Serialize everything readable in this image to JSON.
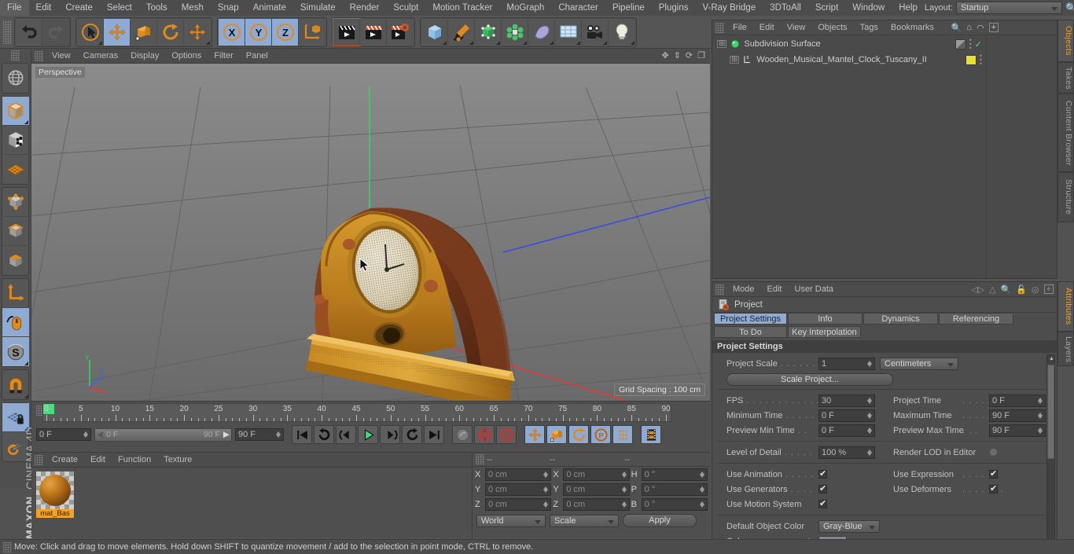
{
  "app": {
    "name": "MAXON CINEMA 4D",
    "brand_line1": "MAXON",
    "brand_line2": "CINEMA 4D"
  },
  "menubar": {
    "items": [
      "File",
      "Edit",
      "Create",
      "Select",
      "Tools",
      "Mesh",
      "Snap",
      "Animate",
      "Simulate",
      "Render",
      "Sculpt",
      "Motion Tracker",
      "MoGraph",
      "Character",
      "Pipeline",
      "Plugins",
      "V-Ray Bridge",
      "3DToAll",
      "Script",
      "Window",
      "Help"
    ],
    "layout_label": "Layout:",
    "layout_value": "Startup",
    "search_icon": "search-icon"
  },
  "toolbar": {
    "groups": [
      {
        "name": "undo-redo",
        "buttons": [
          {
            "name": "undo-button",
            "icon": "undo-arrow-icon",
            "active": false,
            "enabled": true
          },
          {
            "name": "redo-button",
            "icon": "redo-arrow-icon",
            "active": false,
            "enabled": false
          }
        ]
      },
      {
        "name": "transform-tools",
        "buttons": [
          {
            "name": "live-selection-tool",
            "icon": "cursor-circle-icon",
            "active": false,
            "corner": true
          },
          {
            "name": "move-tool",
            "icon": "move-arrows-icon",
            "active": true
          },
          {
            "name": "scale-tool",
            "icon": "scale-box-icon",
            "active": false
          },
          {
            "name": "rotate-tool",
            "icon": "rotate-arc-icon",
            "active": false
          },
          {
            "name": "move-duplicate-tool",
            "icon": "move-arrows-icon",
            "active": false,
            "corner": true
          }
        ]
      },
      {
        "name": "axis-locks",
        "buttons": [
          {
            "name": "lock-x-axis",
            "icon": "x-axis-icon",
            "label": "X",
            "active": true
          },
          {
            "name": "lock-y-axis",
            "icon": "y-axis-icon",
            "label": "Y",
            "active": true
          },
          {
            "name": "lock-z-axis",
            "icon": "z-axis-icon",
            "label": "Z",
            "active": true
          },
          {
            "name": "world-object-coordinates",
            "icon": "world-axis-cube-icon",
            "active": false
          }
        ]
      },
      {
        "name": "render-tools",
        "buttons": [
          {
            "name": "render-view-button",
            "icon": "clapperboard-icon",
            "active": false,
            "selected": true
          },
          {
            "name": "render-region-button",
            "icon": "clapperboard-region-icon",
            "active": false
          },
          {
            "name": "render-settings-button",
            "icon": "clapperboard-gear-icon",
            "active": false
          }
        ]
      },
      {
        "name": "create-objects",
        "buttons": [
          {
            "name": "add-cube-button",
            "icon": "cube-icon",
            "active": false,
            "corner": true
          },
          {
            "name": "add-spline-button",
            "icon": "pen-spline-icon",
            "active": false,
            "corner": true
          },
          {
            "name": "add-generator-button",
            "icon": "generator-cube-icon",
            "active": false,
            "corner": true
          },
          {
            "name": "add-array-button",
            "icon": "array-icon",
            "active": false,
            "corner": true
          },
          {
            "name": "add-deformer-button",
            "icon": "bend-deformer-icon",
            "active": false,
            "corner": true
          },
          {
            "name": "add-scene-button",
            "icon": "floor-grid-icon",
            "active": false,
            "corner": true
          },
          {
            "name": "add-camera-button",
            "icon": "camera-icon",
            "active": false,
            "corner": true
          },
          {
            "name": "add-light-button",
            "icon": "light-bulb-icon",
            "active": false,
            "corner": true
          }
        ]
      }
    ]
  },
  "left_toolbar": {
    "groups": [
      {
        "name": "texture-axis",
        "buttons": [
          {
            "name": "texture-axis-tool",
            "icon": "globe-axis-icon",
            "active": false
          }
        ]
      },
      {
        "name": "editable-modes",
        "buttons": [
          {
            "name": "make-editable-button",
            "icon": "cube-outline-icon",
            "active": true,
            "corner": true
          },
          {
            "name": "model-texture-mode",
            "icon": "checker-cube-icon",
            "active": false
          },
          {
            "name": "texture-mode",
            "icon": "texture-grid-icon",
            "active": false
          }
        ]
      },
      {
        "name": "component-modes",
        "buttons": [
          {
            "name": "points-mode",
            "icon": "points-cube-icon",
            "active": false
          },
          {
            "name": "edges-mode",
            "icon": "edges-cube-icon",
            "active": false
          },
          {
            "name": "polygons-mode",
            "icon": "polygons-cube-icon",
            "active": false
          }
        ]
      },
      {
        "name": "axis-modes",
        "buttons": [
          {
            "name": "enable-axis-modification",
            "icon": "axis-corner-icon",
            "active": false
          },
          {
            "name": "viewport-solo-mouse",
            "icon": "mouse-icon",
            "active": true
          },
          {
            "name": "soft-selection-tool",
            "icon": "soft-selection-icon",
            "active": true,
            "corner": true
          }
        ]
      },
      {
        "name": "snap-group",
        "buttons": [
          {
            "name": "enable-snapping",
            "icon": "magnet-icon",
            "active": false,
            "corner": true
          }
        ]
      },
      {
        "name": "workplane-group",
        "buttons": [
          {
            "name": "lock-workplane",
            "icon": "workplane-lock-icon",
            "active": true,
            "corner": true
          },
          {
            "name": "workplane-mode",
            "icon": "workplane-icon",
            "active": false
          }
        ]
      }
    ]
  },
  "viewport": {
    "menu_items": [
      "View",
      "Cameras",
      "Display",
      "Options",
      "Filter",
      "Panel"
    ],
    "label": "Perspective",
    "grid_spacing": "Grid Spacing : 100 cm",
    "icons": [
      "move-view-icon",
      "zoom-view-icon",
      "rotate-view-icon",
      "maximize-view-icon"
    ]
  },
  "timeline": {
    "tick_labels": [
      "0",
      "5",
      "10",
      "15",
      "20",
      "25",
      "30",
      "35",
      "40",
      "45",
      "50",
      "55",
      "60",
      "65",
      "70",
      "75",
      "80",
      "85",
      "90"
    ],
    "current_frame_field": "0 F",
    "start_field": "0 F",
    "end_field": "90 F",
    "range_start": "0 F",
    "range_end": "90 F",
    "fps_field": "90 F",
    "controls": [
      {
        "name": "go-to-start-button",
        "icon": "skip-start-icon",
        "active": false
      },
      {
        "name": "play-backwards-loop-button",
        "icon": "loop-back-icon",
        "active": false
      },
      {
        "name": "step-back-button",
        "icon": "prev-frame-icon",
        "active": false
      },
      {
        "name": "play-button",
        "icon": "play-icon",
        "active": false
      },
      {
        "name": "step-forward-button",
        "icon": "next-frame-icon",
        "active": false
      },
      {
        "name": "play-forward-loop-button",
        "icon": "loop-forward-icon",
        "active": false
      },
      {
        "name": "go-to-end-button",
        "icon": "skip-end-icon",
        "active": false
      },
      {
        "name": "record-active-objects-button",
        "icon": "key-icon",
        "active": false
      },
      {
        "name": "autokeying-button",
        "icon": "record-circle-icon",
        "active": false
      },
      {
        "name": "keyframe-selection-button",
        "icon": "question-circle-icon",
        "active": false
      },
      {
        "name": "position-key-toggle",
        "icon": "move-arrows-icon",
        "active": true
      },
      {
        "name": "scale-key-toggle",
        "icon": "scale-box-icon",
        "active": true
      },
      {
        "name": "rotation-key-toggle",
        "icon": "rotate-arc-icon",
        "active": true
      },
      {
        "name": "parameter-key-toggle",
        "icon": "param-p-icon",
        "active": true
      },
      {
        "name": "point-level-animation-toggle",
        "icon": "dots-grid-icon",
        "active": true
      },
      {
        "name": "timeline-filmstrip-button",
        "icon": "filmstrip-icon",
        "active": true
      }
    ]
  },
  "material_manager": {
    "menu_items": [
      "Create",
      "Edit",
      "Function",
      "Texture"
    ],
    "materials": [
      {
        "name": "mat_Bas",
        "selected": true
      }
    ]
  },
  "coordinates": {
    "header_cells": [
      "--",
      "--",
      "--"
    ],
    "rows": [
      {
        "pos_label": "X",
        "pos_value": "0 cm",
        "size_label": "X",
        "size_value": "0 cm",
        "rot_label": "H",
        "rot_value": "0 °"
      },
      {
        "pos_label": "Y",
        "pos_value": "0 cm",
        "size_label": "Y",
        "size_value": "0 cm",
        "rot_label": "P",
        "rot_value": "0 °"
      },
      {
        "pos_label": "Z",
        "pos_value": "0 cm",
        "size_label": "Z",
        "size_value": "0 cm",
        "rot_label": "B",
        "rot_value": "0 °"
      }
    ],
    "system_select": "World",
    "mode_select": "Scale",
    "apply_label": "Apply"
  },
  "object_manager": {
    "menu_items": [
      "File",
      "Edit",
      "View",
      "Objects",
      "Tags",
      "Bookmarks"
    ],
    "header_icons": [
      "search-icon",
      "home-icon",
      "eye-icon",
      "plus-icon"
    ],
    "objects": [
      {
        "name": "Subdivision Surface",
        "icon": "subdivision-surface-icon",
        "indent": 0,
        "tag_color": "#8e8e8e",
        "check": "✓"
      },
      {
        "name": "Wooden_Musical_Mantel_Clock_Tuscany_II",
        "icon": "polygon-object-icon",
        "indent": 1,
        "tag_color": "#e8e030",
        "check": ""
      }
    ],
    "tabs": [
      {
        "label": "Objects",
        "selected": true
      },
      {
        "label": "Takes",
        "selected": false
      },
      {
        "label": "Content Browser",
        "selected": false
      },
      {
        "label": "Structure",
        "selected": false
      }
    ]
  },
  "attribute_manager": {
    "menu_items": [
      "Mode",
      "Edit",
      "User Data"
    ],
    "header_icons": [
      "nav-back-icon",
      "nav-up-icon",
      "search-icon",
      "lock-icon",
      "target-icon",
      "plus-icon"
    ],
    "object_title": "Project",
    "object_icon": "project-gear-icon",
    "tabs_row1": [
      {
        "label": "Project Settings",
        "selected": true
      },
      {
        "label": "Info",
        "selected": false
      },
      {
        "label": "Dynamics",
        "selected": false
      },
      {
        "label": "Referencing",
        "selected": false
      }
    ],
    "tabs_row2": [
      {
        "label": "To Do",
        "selected": false
      },
      {
        "label": "Key Interpolation",
        "selected": false
      }
    ],
    "group_title": "Project Settings",
    "project_scale_label": "Project Scale",
    "project_scale_dots": ". . . . . .",
    "project_scale_value": "1",
    "project_scale_unit": "Centimeters",
    "scale_project_button": "Scale Project...",
    "fields": [
      {
        "label": "FPS",
        "dots": ". . . . . . . . . . . . .",
        "value": "30",
        "label2": "Project Time",
        "dots2": ". . . . . . . .",
        "value2": "0 F"
      },
      {
        "label": "Minimum Time",
        "dots": ". . . . .",
        "value": "0 F",
        "label2": "Maximum Time",
        "dots2": ". . . . . .",
        "value2": "90 F"
      },
      {
        "label": "Preview Min Time",
        "dots": ". .",
        "value": "0 F",
        "label2": "Preview Max Time",
        "dots2": ". . .",
        "value2": "90 F"
      }
    ],
    "lod_label": "Level of Detail",
    "lod_dots": ". . . . .",
    "lod_value": "100 %",
    "render_lod_label": "Render LOD in Editor",
    "render_lod_checked": false,
    "toggles": [
      {
        "label": "Use Animation",
        "dots": ". . . . . .",
        "checked": true,
        "label2": "Use Expression",
        "dots2": ". . . . . .",
        "checked2": true
      },
      {
        "label": "Use Generators",
        "dots": ". . . .",
        "checked": true,
        "label2": "Use Deformers",
        "dots2": ". . . . . . .",
        "checked2": true
      },
      {
        "label": "Use Motion System",
        "dots": "",
        "checked": true,
        "label2": "",
        "dots2": "",
        "checked2": null
      }
    ],
    "default_object_color_label": "Default Object Color",
    "default_object_color_value": "Gray-Blue",
    "color_label": "Color",
    "color_dots": ". . . . . . . . . .",
    "color_swatch": "#7b8a9e",
    "tabs": [
      {
        "label": "Attributes",
        "selected": true
      },
      {
        "label": "Layers",
        "selected": false
      }
    ]
  },
  "status_bar": {
    "message": "Move: Click and drag to move elements. Hold down SHIFT to quantize movement / add to the selection in point mode, CTRL to remove."
  },
  "colors": {
    "accent_blue": "#8fabd4",
    "accent_orange": "#e8a13c",
    "panel_bg": "#4d4d4d",
    "toolbar_bg": "#555555",
    "text": "#c8c8c8"
  }
}
